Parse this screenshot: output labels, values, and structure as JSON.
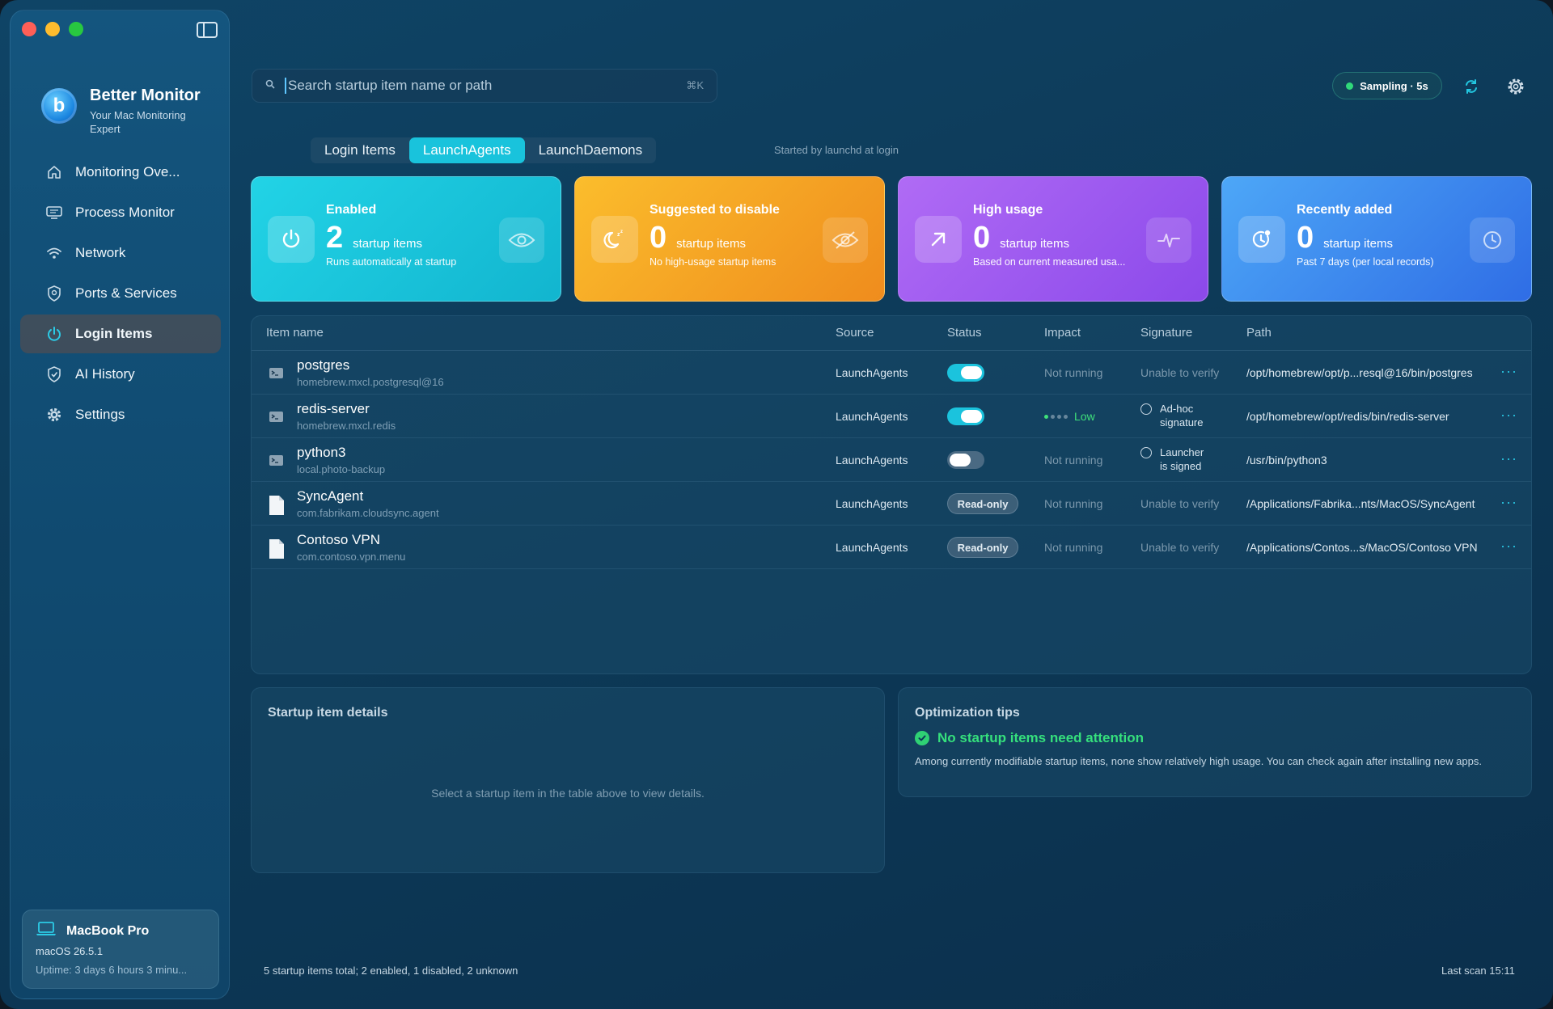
{
  "sidebar": {
    "brand_title": "Better Monitor",
    "brand_subtitle": "Your Mac Monitoring Expert",
    "logo_letter": "b",
    "items": [
      {
        "label": "Monitoring Ove...",
        "icon": "home-icon"
      },
      {
        "label": "Process Monitor",
        "icon": "monitor-icon"
      },
      {
        "label": "Network",
        "icon": "wifi-icon"
      },
      {
        "label": "Ports & Services",
        "icon": "shield-icon"
      },
      {
        "label": "Login Items",
        "icon": "power-icon",
        "active": true
      },
      {
        "label": "AI History",
        "icon": "shield-check-icon"
      },
      {
        "label": "Settings",
        "icon": "gear-icon"
      }
    ],
    "device": {
      "name": "MacBook Pro",
      "os": "macOS 26.5.1",
      "uptime": "Uptime: 3 days 6 hours 3 minu..."
    }
  },
  "topbar": {
    "search_placeholder": "Search startup item name or path",
    "search_shortcut": "⌘K",
    "sampling_label": "Sampling · 5s"
  },
  "tabs": [
    {
      "label": "Login Items",
      "active": false
    },
    {
      "label": "LaunchAgents",
      "active": true
    },
    {
      "label": "LaunchDaemons",
      "active": false
    }
  ],
  "tab_hint": "Started by launchd at login",
  "cards": [
    {
      "title": "Enabled",
      "count": "2",
      "unit": "startup items",
      "desc": "Runs automatically at startup",
      "icon": "power-icon",
      "side_icon": "eye-icon"
    },
    {
      "title": "Suggested to disable",
      "count": "0",
      "unit": "startup items",
      "desc": "No high-usage startup items",
      "icon": "sleep-moon-icon",
      "side_icon": "eye-slash-icon"
    },
    {
      "title": "High usage",
      "count": "0",
      "unit": "startup items",
      "desc": "Based on current measured usa...",
      "icon": "arrow-up-right-icon",
      "side_icon": "pulse-icon"
    },
    {
      "title": "Recently added",
      "count": "0",
      "unit": "startup items",
      "desc": "Past 7 days (per local records)",
      "icon": "clock-badge-icon",
      "side_icon": "clock-icon"
    }
  ],
  "table": {
    "headers": [
      "Item name",
      "Source",
      "Status",
      "Impact",
      "Signature",
      "Path"
    ],
    "rows": [
      {
        "name": "postgres",
        "id": "homebrew.mxcl.postgresql@16",
        "source": "LaunchAgents",
        "status": "on",
        "impact": "Not running",
        "signature": "Unable to verify",
        "sig_badge": false,
        "path": "/opt/homebrew/opt/p...resql@16/bin/postgres",
        "icon": "terminal-icon"
      },
      {
        "name": "redis-server",
        "id": "homebrew.mxcl.redis",
        "source": "LaunchAgents",
        "status": "on",
        "impact": "Low",
        "signature": "Ad-hoc signature",
        "sig_badge": true,
        "path": "/opt/homebrew/opt/redis/bin/redis-server",
        "icon": "terminal-icon"
      },
      {
        "name": "python3",
        "id": "local.photo-backup",
        "source": "LaunchAgents",
        "status": "off",
        "impact": "Not running",
        "signature": "Launcher is signed",
        "sig_badge": true,
        "path": "/usr/bin/python3",
        "icon": "terminal-icon"
      },
      {
        "name": "SyncAgent",
        "id": "com.fabrikam.cloudsync.agent",
        "source": "LaunchAgents",
        "status": "Read-only",
        "impact": "Not running",
        "signature": "Unable to verify",
        "sig_badge": false,
        "path": "/Applications/Fabrika...nts/MacOS/SyncAgent",
        "icon": "document-icon"
      },
      {
        "name": "Contoso VPN",
        "id": "com.contoso.vpn.menu",
        "source": "LaunchAgents",
        "status": "Read-only",
        "impact": "Not running",
        "signature": "Unable to verify",
        "sig_badge": false,
        "path": "/Applications/Contos...s/MacOS/Contoso VPN",
        "icon": "document-icon"
      }
    ]
  },
  "details": {
    "title": "Startup item details",
    "empty": "Select a startup item in the table above to view details."
  },
  "tips": {
    "title": "Optimization tips",
    "headline": "No startup items need attention",
    "body": "Among currently modifiable startup items, none show relatively high usage. You can check again after installing new apps."
  },
  "footer": {
    "summary": "5 startup items total; 2 enabled, 1 disabled, 2 unknown",
    "last_scan": "Last scan 15:11"
  },
  "colors": {
    "accent": "#1bc3dd",
    "enabled_card": "#22d3e6",
    "suggest_card": "#fbbd2c",
    "high_card": "#b06bf5",
    "recent_card": "#4da7f7",
    "ok_green": "#35e07c"
  }
}
